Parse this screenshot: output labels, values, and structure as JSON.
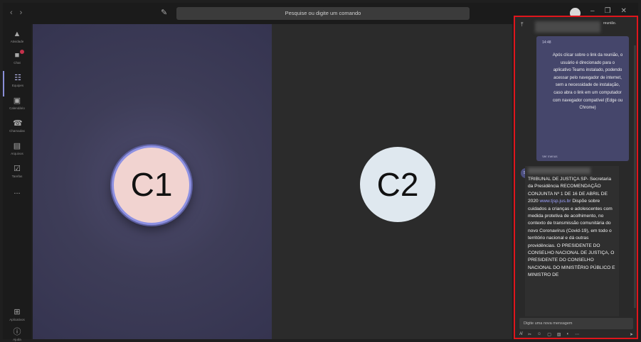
{
  "topbar": {
    "back_icon": "chevron-left-icon",
    "forward_icon": "chevron-right-icon",
    "search_placeholder": "Pesquise ou digite um comando",
    "window_controls": [
      "minimize-icon",
      "restore-icon",
      "close-icon"
    ]
  },
  "rail": {
    "items": [
      {
        "label": "Atividade",
        "icon": "bell-icon"
      },
      {
        "label": "Chat",
        "icon": "chat-icon",
        "badge": true
      },
      {
        "label": "Equipes",
        "icon": "teams-icon",
        "active": true
      },
      {
        "label": "Calendário",
        "icon": "calendar-icon"
      },
      {
        "label": "Chamadas",
        "icon": "phone-icon"
      },
      {
        "label": "Arquivos",
        "icon": "file-icon"
      },
      {
        "label": "Tarefas",
        "icon": "tasks-icon"
      },
      {
        "label": "...",
        "icon": "more-icon"
      }
    ],
    "bottom": [
      {
        "label": "Aplicativos",
        "icon": "apps-icon"
      },
      {
        "label": "Ajuda",
        "icon": "help-icon"
      }
    ]
  },
  "stage": {
    "left_participant": "C1",
    "right_participant": "C2",
    "left_bg": "#3e3d58",
    "right_bg": "#2b2b2b",
    "highlight_ring": "#8e91e2"
  },
  "chat": {
    "header_text": "reunião.",
    "message1": {
      "time": "14:48",
      "body": "Após clicar sobre o link da reunião, o usuário é direcionado para o aplicativo Teams instalado, podendo acessar pelo navegador de internet, sem a necessidade de instalação, caso abra o link em um computador com navegador compatível (Edge ou Chrome)",
      "meta": "Ver menos"
    },
    "message2": {
      "avatar": "SP",
      "body_before_link": "TRIBUNAL DE JUSTIÇA SP- Secretaria da Presidência RECOMENDAÇÃO CONJUNTA Nº 1 DE 16 DE ABRIL DE 2020 ",
      "link": "www.tjsp.jus.br",
      "body_after_link": " Dispõe sobre cuidados a crianças e adolescentes com medida protetiva de acolhimento, no contexto de transmissão comunitária do novo Coronavírus (Covid-19), em todo o território nacional e dá outras providências. O PRESIDENTE DO CONSELHO NACIONAL DE JUSTIÇA, O PRESIDENTE DO CONSELHO NACIONAL DO MINISTÉRIO PÚBLICO E MINISTRO DE"
    },
    "compose_placeholder": "Digite uma nova mensagem",
    "toolbar_icons": [
      "format-icon",
      "attach-icon",
      "emoji-icon",
      "gif-icon",
      "sticker-icon",
      "meet-icon",
      "more-icon",
      "send-icon"
    ],
    "border_color": "#e0151c"
  }
}
